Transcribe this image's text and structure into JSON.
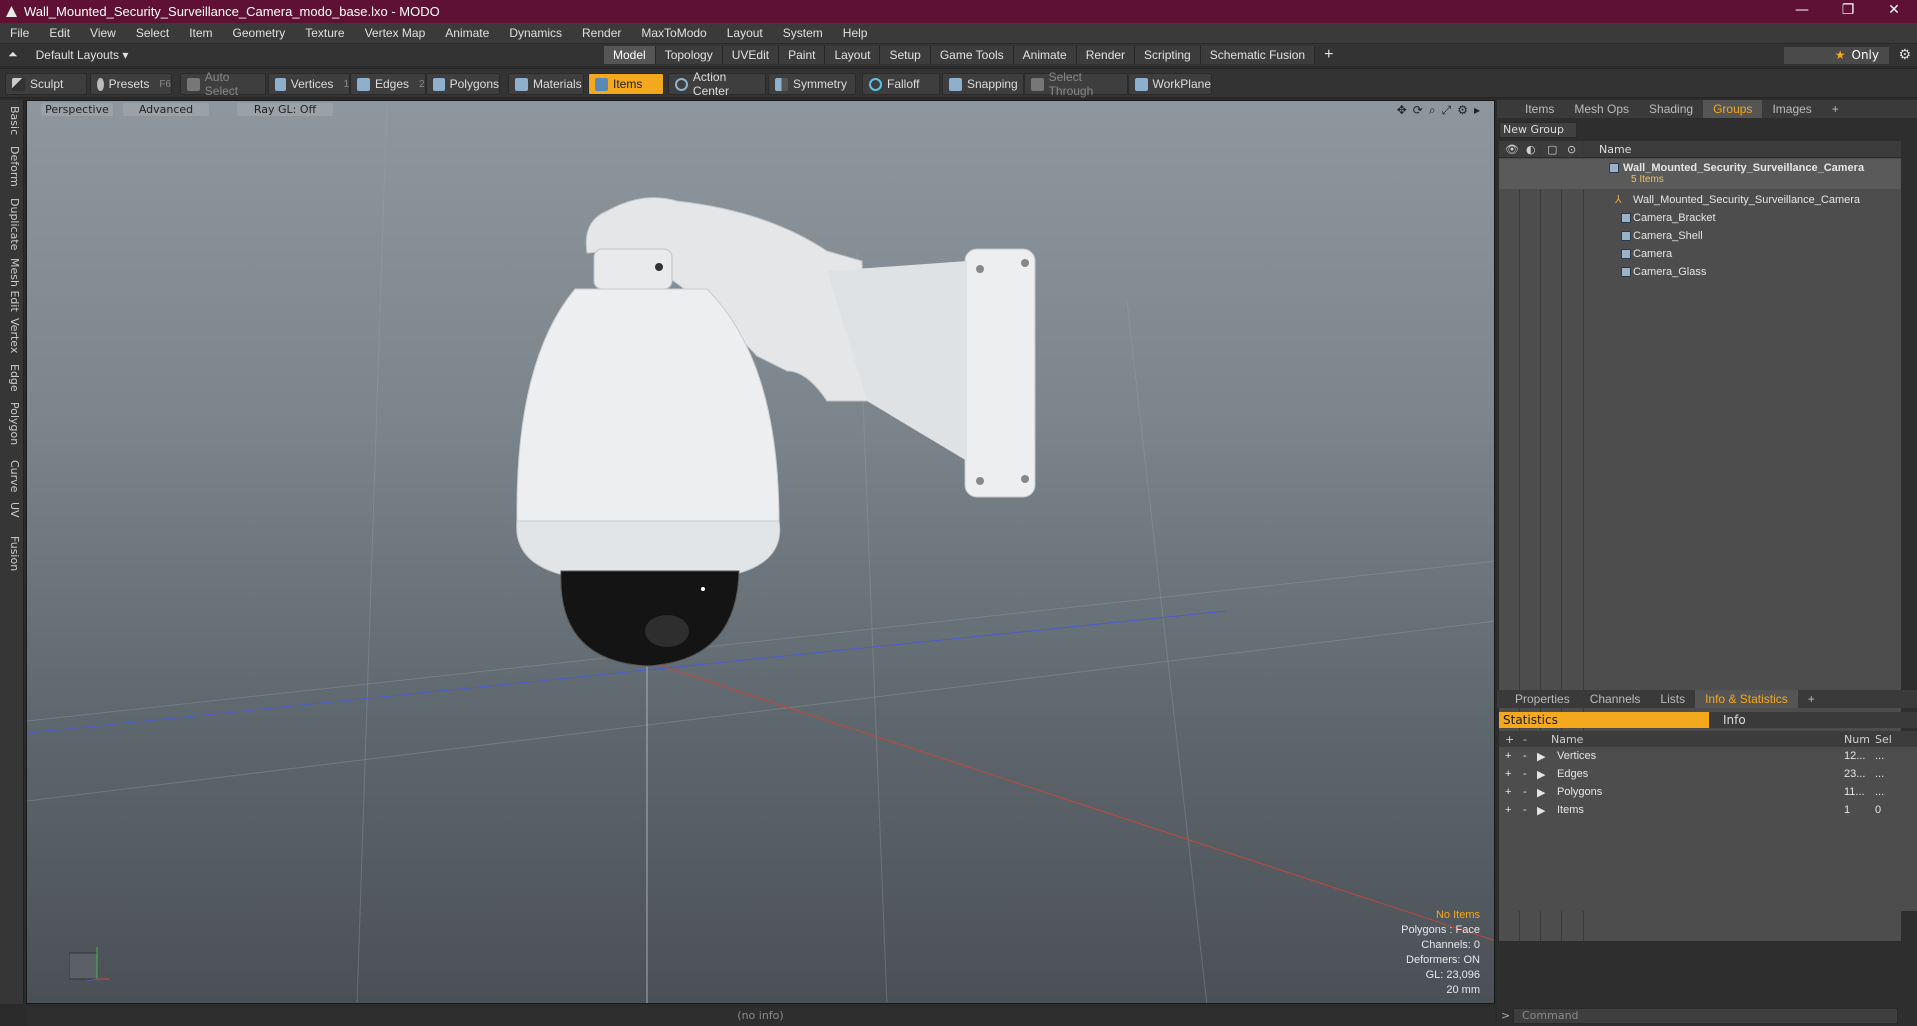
{
  "window": {
    "title": "Wall_Mounted_Security_Surveillance_Camera_modo_base.lxo - MODO",
    "minimize": "—",
    "maximize": "❐",
    "close": "✕"
  },
  "menu": [
    "File",
    "Edit",
    "View",
    "Select",
    "Item",
    "Geometry",
    "Texture",
    "Vertex Map",
    "Animate",
    "Dynamics",
    "Render",
    "MaxToModo",
    "Layout",
    "System",
    "Help"
  ],
  "layouts": {
    "label": "Default Layouts",
    "tabs": [
      "Model",
      "Topology",
      "UVEdit",
      "Paint",
      "Layout",
      "Setup",
      "Game Tools",
      "Animate",
      "Render",
      "Scripting",
      "Schematic Fusion"
    ],
    "active_tab": "Model",
    "plus": "+",
    "only_label": "Only"
  },
  "toolbar": {
    "sculpt": "Sculpt",
    "presets": "Presets",
    "presets_key": "F6",
    "auto_select": "Auto Select",
    "vertices": "Vertices",
    "vertices_key": "1",
    "edges": "Edges",
    "edges_key": "2",
    "polygons": "Polygons",
    "materials": "Materials",
    "items": "Items",
    "action_center": "Action Center",
    "symmetry": "Symmetry",
    "falloff": "Falloff",
    "snapping": "Snapping",
    "select_through": "Select Through",
    "workplane": "WorkPlane"
  },
  "left_tabs": [
    "Basic",
    "Deform",
    "Duplicate",
    "Mesh Edit",
    "Vertex",
    "Edge",
    "Polygon",
    "Curve",
    "UV",
    "Fusion"
  ],
  "viewport": {
    "view": "Perspective",
    "mode": "Advanced",
    "raygl": "Ray GL: Off",
    "info": {
      "items": "No Items",
      "polygons": "Polygons : Face",
      "channels": "Channels: 0",
      "deformers": "Deformers: ON",
      "gl": "GL: 23,096",
      "scale": "20 mm"
    }
  },
  "status": "(no info)",
  "right_panel": {
    "tabs": [
      "Items",
      "Mesh Ops",
      "Shading",
      "Groups",
      "Images"
    ],
    "active_tab": "Groups",
    "new_group": "New Group",
    "name_header": "Name",
    "root": {
      "name": "Wall_Mounted_Security_Surveillance_Camera",
      "count": "5 Items"
    },
    "children": [
      "Wall_Mounted_Security_Surveillance_Camera",
      "Camera_Bracket",
      "Camera_Shell",
      "Camera",
      "Camera_Glass"
    ]
  },
  "bottom_panel": {
    "tabs": [
      "Properties",
      "Channels",
      "Lists",
      "Info & Statistics"
    ],
    "active_tab": "Info & Statistics",
    "stat_tab": "Statistics",
    "info_tab": "Info",
    "headers": {
      "name": "Name",
      "num": "Num",
      "sel": "Sel"
    },
    "rows": [
      {
        "name": "Vertices",
        "num": "12...",
        "sel": "..."
      },
      {
        "name": "Edges",
        "num": "23...",
        "sel": "..."
      },
      {
        "name": "Polygons",
        "num": "11...",
        "sel": "..."
      },
      {
        "name": "Items",
        "num": "1",
        "sel": "0"
      }
    ]
  },
  "command": {
    "placeholder": "Command"
  },
  "colors": {
    "accent": "#f4a81d",
    "titlebar": "#5e1133"
  }
}
